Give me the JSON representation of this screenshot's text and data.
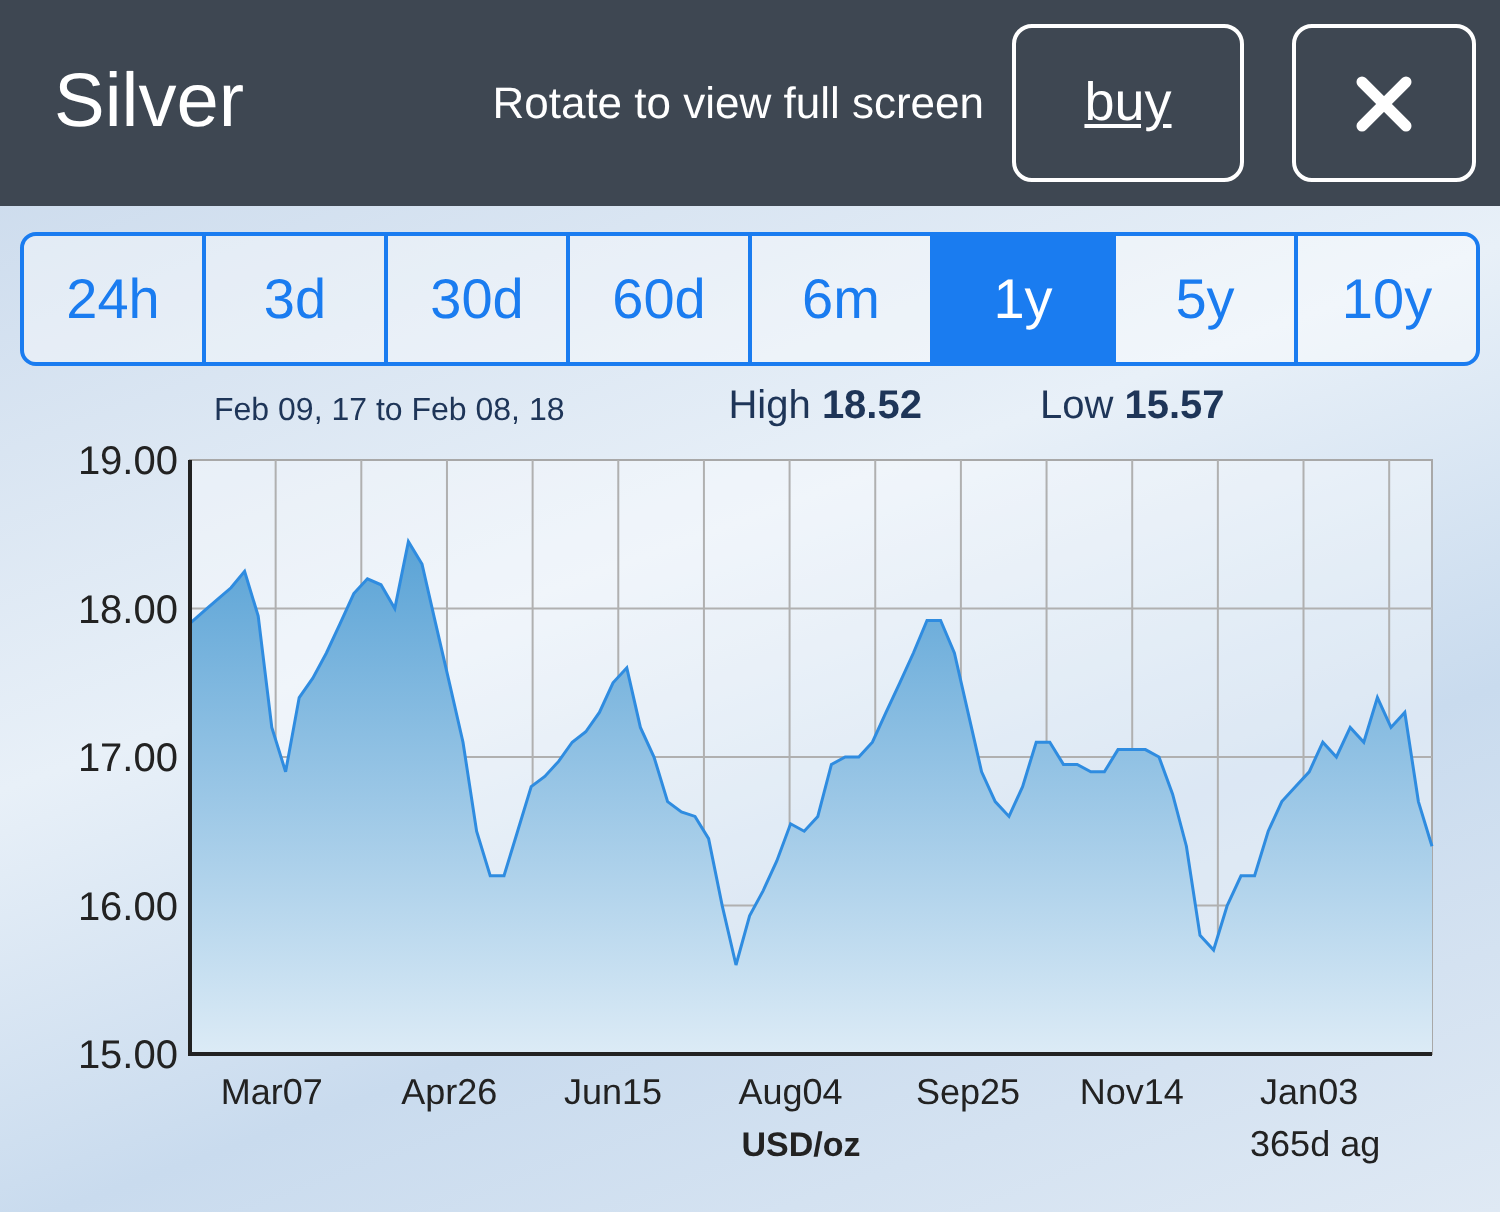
{
  "header": {
    "title": "Silver",
    "hint": "Rotate to view full screen",
    "buy_button": "buy"
  },
  "tabs": [
    {
      "label": "24h",
      "selected": false
    },
    {
      "label": "3d",
      "selected": false
    },
    {
      "label": "30d",
      "selected": false
    },
    {
      "label": "60d",
      "selected": false
    },
    {
      "label": "6m",
      "selected": false
    },
    {
      "label": "1y",
      "selected": true
    },
    {
      "label": "5y",
      "selected": false
    },
    {
      "label": "10y",
      "selected": false
    }
  ],
  "chart_info": {
    "range": "Feb 09, 17 to Feb 08, 18",
    "high": "High **18.52**",
    "low": "Low **15.57**"
  },
  "chart_data": {
    "type": "area",
    "grid": true,
    "xlabel": "USD/oz",
    "ylim": [
      15,
      19
    ],
    "yticks": [
      {
        "value": 15,
        "label": "15.00"
      },
      {
        "value": 16,
        "label": "16.00"
      },
      {
        "value": 17,
        "label": "17.00"
      },
      {
        "value": 18,
        "label": "18.00"
      },
      {
        "value": 19,
        "label": "19.00"
      }
    ],
    "annotations": [
      "365d ag"
    ],
    "categories": [
      null,
      null,
      null,
      null,
      null,
      null,
      "Mar07",
      null,
      null,
      null,
      null,
      null,
      null,
      null,
      null,
      null,
      null,
      null,
      null,
      "Apr26",
      null,
      null,
      null,
      null,
      null,
      null,
      null,
      null,
      null,
      null,
      null,
      "Jun15",
      null,
      null,
      null,
      null,
      null,
      null,
      null,
      null,
      null,
      null,
      null,
      null,
      "Aug04",
      null,
      null,
      null,
      null,
      null,
      null,
      null,
      null,
      null,
      null,
      null,
      null,
      "Sep25",
      null,
      null,
      null,
      null,
      null,
      null,
      null,
      null,
      null,
      null,
      null,
      "Nov14",
      null,
      null,
      null,
      null,
      null,
      null,
      null,
      null,
      null,
      null,
      null,
      null,
      "Jan03",
      null,
      null,
      null,
      null,
      null,
      null,
      null,
      null,
      null
    ],
    "series": [
      {
        "color": "#2f8ce0",
        "values": [
          17.9,
          17.98,
          18.06,
          18.14,
          18.25,
          17.95,
          17.2,
          16.9,
          17.4,
          17.53,
          17.7,
          17.9,
          18.1,
          18.2,
          18.16,
          18.0,
          18.45,
          18.3,
          17.9,
          17.5,
          17.1,
          16.5,
          16.2,
          16.2,
          16.5,
          16.8,
          16.87,
          16.97,
          17.1,
          17.17,
          17.3,
          17.5,
          17.6,
          17.2,
          17.0,
          16.7,
          16.63,
          16.6,
          16.45,
          16.0,
          15.6,
          15.93,
          16.1,
          16.3,
          16.55,
          16.5,
          16.6,
          16.95,
          17.0,
          17.0,
          17.1,
          17.3,
          17.5,
          17.7,
          17.92,
          17.92,
          17.7,
          17.3,
          16.9,
          16.7,
          16.6,
          16.8,
          17.1,
          17.1,
          16.95,
          16.95,
          16.9,
          16.9,
          17.05,
          17.05,
          17.05,
          17.0,
          16.75,
          16.4,
          15.8,
          15.7,
          16.0,
          16.2,
          16.2,
          16.5,
          16.7,
          16.8,
          16.9,
          17.1,
          17.0,
          17.2,
          17.1,
          17.4,
          17.2,
          17.3,
          16.7,
          16.4
        ]
      }
    ]
  }
}
